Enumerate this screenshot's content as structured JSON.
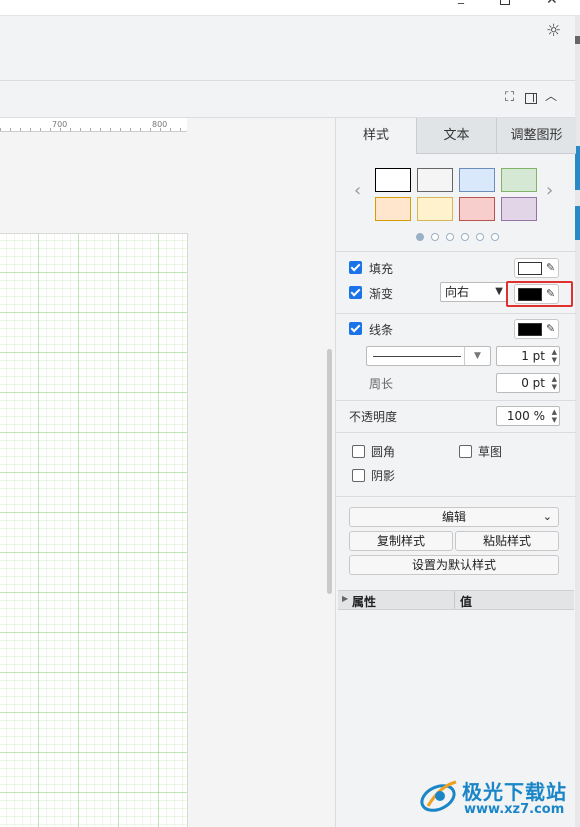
{
  "window": {
    "minimize_glyph": "_",
    "close_glyph": "✕"
  },
  "toolbar": {
    "theme_icon": "sun-icon",
    "fullscreen_icon": "fullscreen-icon",
    "format_panel_icon": "panel-toggle-icon",
    "collapse_icon": "chevron-up-icon"
  },
  "ruler": {
    "labels": [
      "700",
      "800"
    ]
  },
  "format_panel": {
    "tabs": [
      {
        "label": "样式",
        "active": true
      },
      {
        "label": "文本",
        "active": false
      },
      {
        "label": "调整图形",
        "active": false
      }
    ],
    "style_nav": {
      "prev": "‹",
      "next": "›"
    },
    "style_swatches": [
      {
        "fill": "#ffffff",
        "stroke": "#000000"
      },
      {
        "fill": "#f5f5f5",
        "stroke": "#666666"
      },
      {
        "fill": "#dae8fc",
        "stroke": "#6c8ebf"
      },
      {
        "fill": "#d5e8d4",
        "stroke": "#82b366"
      },
      {
        "fill": "#ffe6cc",
        "stroke": "#d79b00"
      },
      {
        "fill": "#fff2cc",
        "stroke": "#d6b656"
      },
      {
        "fill": "#f8cecc",
        "stroke": "#b85450"
      },
      {
        "fill": "#e1d5e7",
        "stroke": "#9673a6"
      }
    ],
    "style_pages": 6,
    "style_page_active": 1,
    "fill": {
      "label": "填充",
      "checked": true,
      "color": "#ffffff"
    },
    "gradient": {
      "label": "渐变",
      "checked": true,
      "direction": "向右",
      "color": "#000000"
    },
    "line": {
      "label": "线条",
      "checked": true,
      "color": "#000000",
      "width": "1 pt"
    },
    "perimeter": {
      "label": "周长",
      "value": "0 pt"
    },
    "opacity": {
      "label": "不透明度",
      "value": "100 %"
    },
    "rounded": {
      "label": "圆角",
      "checked": false
    },
    "sketch": {
      "label": "草图",
      "checked": false
    },
    "shadow": {
      "label": "阴影",
      "checked": false
    },
    "edit_label": "编辑",
    "copy_style_label": "复制样式",
    "paste_style_label": "粘贴样式",
    "set_default_label": "设置为默认样式",
    "properties": {
      "name_header": "属性",
      "value_header": "值"
    }
  },
  "dropper_glyph": "✎",
  "watermark": {
    "text": "极光下载站",
    "url": "www.xz7.com"
  }
}
